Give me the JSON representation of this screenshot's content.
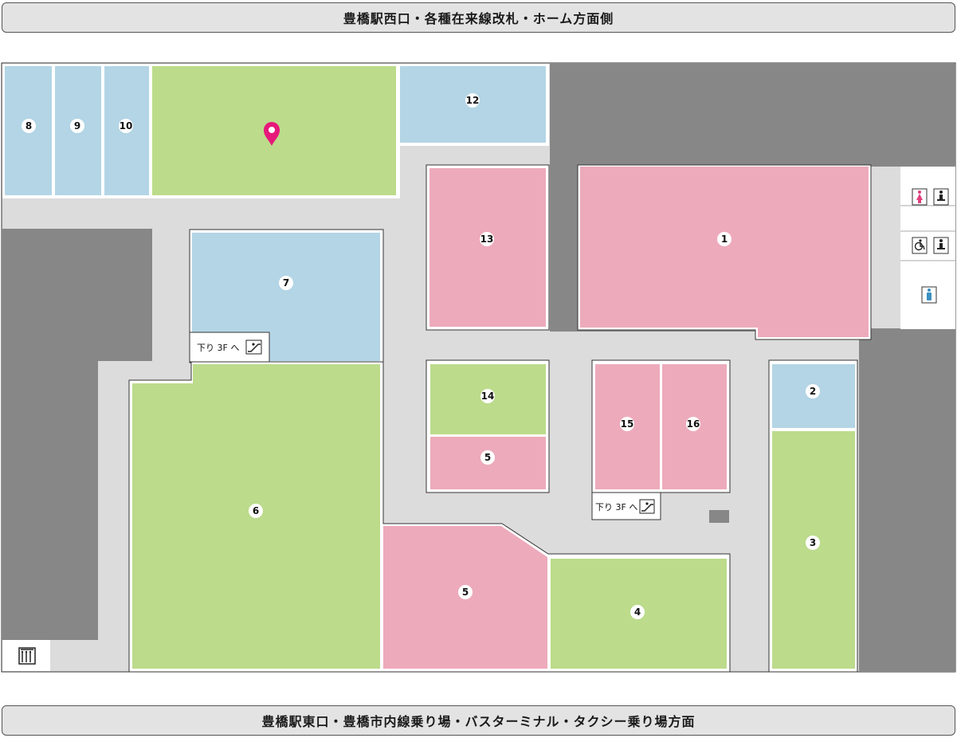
{
  "banners": {
    "top": "豊橋駅西口・各種在来線改札・ホーム方面側",
    "bottom": "豊橋駅東口・豊橋市内線乗り場・バスターミナル・タクシー乗り場方面"
  },
  "colors": {
    "blue": "#b3d5e5",
    "green": "#bcdb8b",
    "pink": "#edaabb",
    "dark_gray": "#878787",
    "corridor": "#dcdcdc",
    "pin": "#e6197a"
  },
  "stores": [
    {
      "id": "8",
      "label": "8",
      "color": "blue"
    },
    {
      "id": "9",
      "label": "9",
      "color": "blue"
    },
    {
      "id": "10",
      "label": "10",
      "color": "blue"
    },
    {
      "id": "11",
      "label": "",
      "color": "green"
    },
    {
      "id": "12",
      "label": "12",
      "color": "blue"
    },
    {
      "id": "13",
      "label": "13",
      "color": "pink"
    },
    {
      "id": "1",
      "label": "1",
      "color": "pink"
    },
    {
      "id": "7",
      "label": "7",
      "color": "blue"
    },
    {
      "id": "6",
      "label": "6",
      "color": "green"
    },
    {
      "id": "14",
      "label": "14",
      "color": "green"
    },
    {
      "id": "5a",
      "label": "5",
      "color": "pink"
    },
    {
      "id": "15",
      "label": "15",
      "color": "pink"
    },
    {
      "id": "16",
      "label": "16",
      "color": "pink"
    },
    {
      "id": "2",
      "label": "2",
      "color": "blue"
    },
    {
      "id": "3",
      "label": "3",
      "color": "green"
    },
    {
      "id": "5b",
      "label": "5",
      "color": "pink"
    },
    {
      "id": "4",
      "label": "4",
      "color": "green"
    }
  ],
  "escalators": [
    {
      "label": "下り 3F へ",
      "icon": "escalator-down-icon"
    },
    {
      "label": "下り 3F へ",
      "icon": "escalator-down-icon"
    }
  ],
  "facilities": {
    "womens_restroom": "womens-restroom-icon",
    "baby_changing": "baby-changing-icon",
    "accessible_restroom": "accessible-restroom-icon",
    "mens_restroom": "mens-restroom-icon",
    "elevator": "elevator-icon",
    "location_pin": "location-pin-icon"
  }
}
